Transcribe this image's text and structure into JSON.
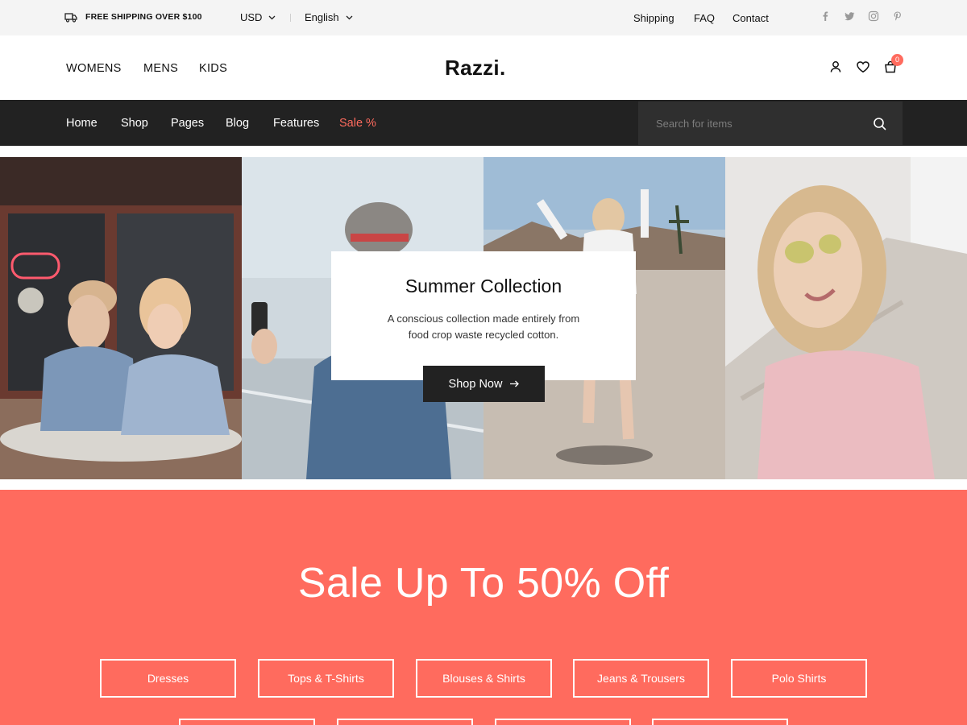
{
  "topbar": {
    "shipping_note": "FREE SHIPPING OVER $100",
    "currency": "USD",
    "language": "English",
    "links": [
      "Shipping",
      "FAQ",
      "Contact"
    ],
    "social_icons": [
      "facebook-icon",
      "twitter-icon",
      "instagram-icon",
      "pinterest-icon"
    ]
  },
  "header": {
    "categories": [
      "WOMENS",
      "MENS",
      "KIDS"
    ],
    "logo": "Razzi.",
    "cart_count": "0",
    "icons": [
      "user-icon",
      "heart-icon",
      "cart-icon"
    ]
  },
  "nav": {
    "items": [
      "Home",
      "Shop",
      "Pages",
      "Blog",
      "Features"
    ],
    "sale_item": "Sale %",
    "search_placeholder": "Search for items"
  },
  "hero": {
    "title": "Summer Collection",
    "description": "A conscious collection made entirely from food crop waste recycled cotton.",
    "cta": "Shop Now"
  },
  "sale": {
    "title": "Sale Up To 50% Off",
    "categories": [
      "Dresses",
      "Tops & T-Shirts",
      "Blouses & Shirts",
      "Jeans & Trousers",
      "Polo Shirts"
    ]
  },
  "colors": {
    "accent": "#ff6b5e",
    "nav_bg": "#222222",
    "topbar_bg": "#f4f4f4"
  }
}
